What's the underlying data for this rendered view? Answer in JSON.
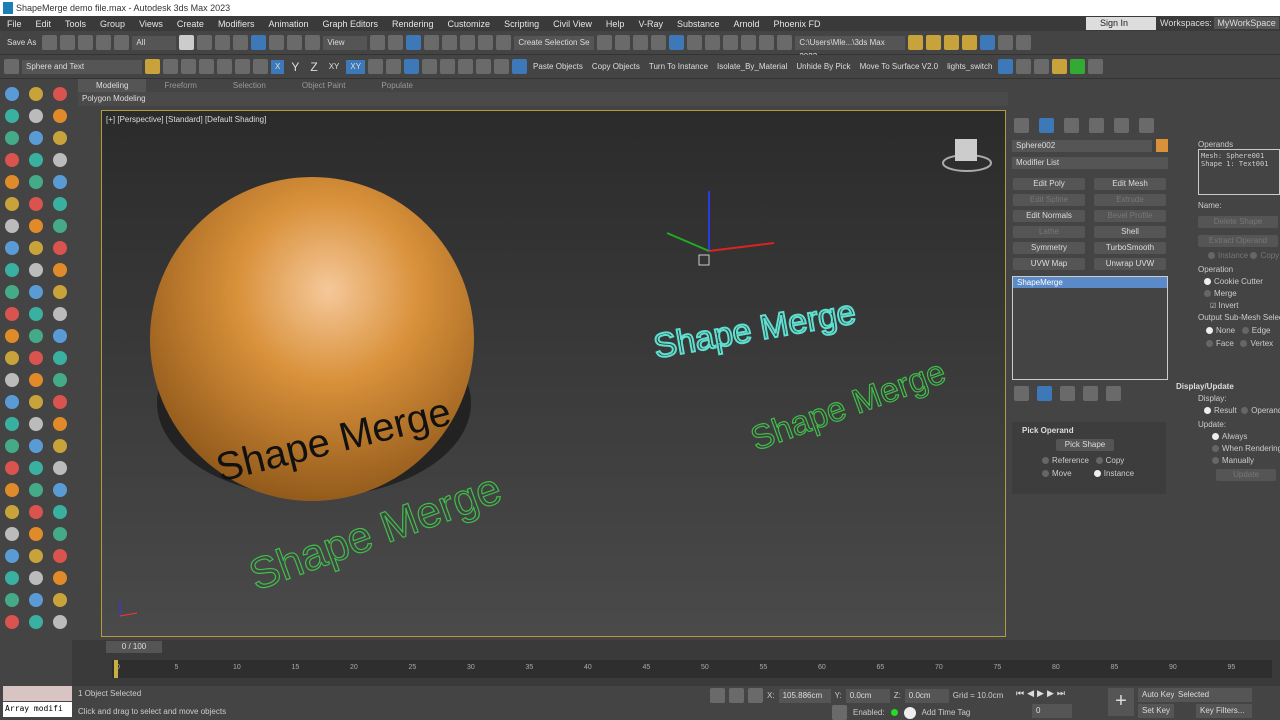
{
  "window": {
    "title": "ShapeMerge demo file.max - Autodesk 3ds Max 2023"
  },
  "menu": [
    "File",
    "Edit",
    "Tools",
    "Group",
    "Views",
    "Create",
    "Modifiers",
    "Animation",
    "Graph Editors",
    "Rendering",
    "Customize",
    "Scripting",
    "Civil View",
    "Help",
    "V-Ray",
    "Substance",
    "Arnold",
    "Phoenix FD"
  ],
  "account": {
    "sign_in": "Sign In",
    "workspaces_label": "Workspaces:",
    "workspace": "MyWorkSpace"
  },
  "toolbar1": {
    "save_as": "Save As",
    "filter": "All",
    "view": "View",
    "selection_set": "Create Selection Se",
    "path": "C:\\Users\\Mle...\\3ds Max 2023"
  },
  "toolbar2": {
    "layer": "Sphere and Text",
    "axes": [
      "X",
      "Y",
      "Z",
      "XY",
      "XY"
    ],
    "scripts": [
      "Paste Objects",
      "Copy Objects",
      "Turn To Instance",
      "Isolate_By_Material",
      "Unhide By Pick",
      "Move To Surface V2.0",
      "lights_switch"
    ]
  },
  "ribbon": {
    "tabs": [
      "Modeling",
      "Freeform",
      "Selection",
      "Object Paint",
      "Populate"
    ],
    "panel": "Polygon Modeling"
  },
  "viewport": {
    "label": "[+] [Perspective] [Standard] [Default Shading]",
    "text": "Shape Merge",
    "sphere_color": "#d9913a",
    "spline_color": "#3fbf4a"
  },
  "command_panel": {
    "object_name": "Sphere002",
    "object_color": "#d9913a",
    "modifier_list": "Modifier List",
    "buttons": [
      {
        "label": "Edit Poly",
        "enabled": true
      },
      {
        "label": "Edit Mesh",
        "enabled": true
      },
      {
        "label": "Edit Spline",
        "enabled": false
      },
      {
        "label": "Extrude",
        "enabled": false
      },
      {
        "label": "Edit Normals",
        "enabled": true
      },
      {
        "label": "Bevel Profile",
        "enabled": false
      },
      {
        "label": "Lathe",
        "enabled": false
      },
      {
        "label": "Shell",
        "enabled": true
      },
      {
        "label": "Symmetry",
        "enabled": true
      },
      {
        "label": "TurboSmooth",
        "enabled": true
      },
      {
        "label": "UVW Map",
        "enabled": true
      },
      {
        "label": "Unwrap UVW",
        "enabled": true
      }
    ],
    "stack": [
      "ShapeMerge"
    ],
    "pick_operand": {
      "title": "Pick Operand",
      "button": "Pick Shape",
      "reference": "Reference",
      "copy": "Copy",
      "move": "Move",
      "instance": "Instance"
    },
    "operands": {
      "title": "Operands",
      "items": [
        "Mesh: Sphere001",
        "Shape 1: Text001"
      ],
      "name_label": "Name:",
      "delete": "Delete Shape",
      "extract": "Extract Operand",
      "instance": "Instance",
      "copy": "Copy"
    },
    "operation": {
      "title": "Operation",
      "cookie": "Cookie Cutter",
      "merge": "Merge",
      "invert": "Invert"
    },
    "output": {
      "title": "Output Sub-Mesh Selection",
      "none": "None",
      "edge": "Edge",
      "face": "Face",
      "vertex": "Vertex"
    },
    "display_update": {
      "title": "Display/Update",
      "display": "Display:",
      "result": "Result",
      "operands": "Operands",
      "update": "Update:",
      "always": "Always",
      "when_rendering": "When Rendering",
      "manually": "Manually",
      "update_btn": "Update"
    }
  },
  "timeline": {
    "frame": "0 / 100",
    "ticks": [
      "0",
      "5",
      "10",
      "15",
      "20",
      "25",
      "30",
      "35",
      "40",
      "45",
      "50",
      "55",
      "60",
      "65",
      "70",
      "75",
      "80",
      "85",
      "90",
      "95"
    ]
  },
  "status": {
    "maxscript": "Array modifi",
    "selected": "1 Object Selected",
    "prompt": "Click and drag to select and move objects",
    "x_label": "X:",
    "x": "105.886cm",
    "y_label": "Y:",
    "y": "0.0cm",
    "z_label": "Z:",
    "z": "0.0cm",
    "grid": "Grid = 10.0cm",
    "enabled": "Enabled:",
    "add_time_tag": "Add Time Tag",
    "frame": "0",
    "auto_key": "Auto Key",
    "set_key": "Set Key",
    "key_mode": "Selected",
    "key_filters": "Key Filters..."
  }
}
